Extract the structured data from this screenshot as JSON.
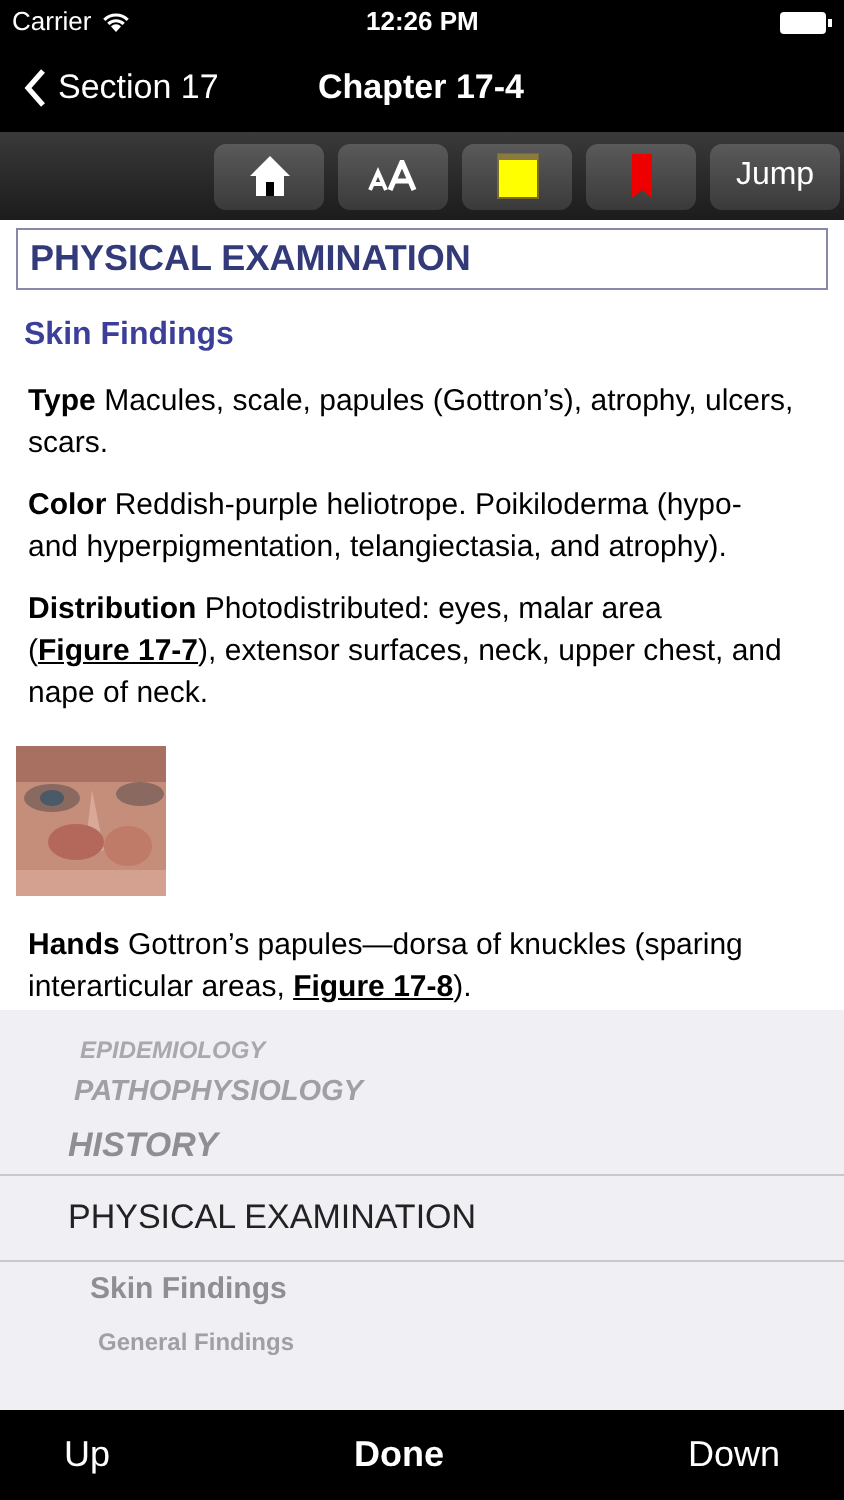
{
  "status_bar": {
    "carrier": "Carrier",
    "time": "12:26 PM"
  },
  "nav": {
    "back": "Section 17",
    "title": "Chapter 17-4"
  },
  "toolbar": {
    "jump": "Jump"
  },
  "content": {
    "heading": "PHYSICAL EXAMINATION",
    "subheading": "Skin Findings",
    "blocks": [
      {
        "kind": "paragraph",
        "parts": [
          {
            "kind": "term",
            "text": "Type"
          },
          {
            "kind": "text",
            "text": " Macules, scale, papules (Gottron’s), atrophy, ulcers, scars."
          }
        ]
      },
      {
        "kind": "paragraph",
        "parts": [
          {
            "kind": "term",
            "text": "Color"
          },
          {
            "kind": "text",
            "text": " Reddish-purple heliotrope. Poikiloderma (hypo- and hyperpigmentation, telangiectasia, and atrophy)."
          }
        ]
      },
      {
        "kind": "paragraph",
        "parts": [
          {
            "kind": "term",
            "text": "Distribution"
          },
          {
            "kind": "text",
            "text": " Photodistributed: eyes, malar area ("
          },
          {
            "kind": "link",
            "text": "Figure 17-7"
          },
          {
            "kind": "text",
            "text": "), extensor surfaces, neck, upper chest, and nape of neck."
          }
        ]
      },
      {
        "kind": "picture"
      },
      {
        "kind": "paragraph",
        "parts": [
          {
            "kind": "term",
            "text": "Hands"
          },
          {
            "kind": "text",
            "text": " Gottron’s papules—dorsa of knuckles (sparing interarticular areas, "
          },
          {
            "kind": "link",
            "text": "Figure 17-8"
          },
          {
            "kind": "text",
            "text": ")."
          }
        ]
      }
    ]
  },
  "picker": {
    "items": [
      {
        "kind": "section",
        "label": "EPIDEMIOLOGY",
        "selected": false
      },
      {
        "kind": "section",
        "label": "PATHOPHYSIOLOGY",
        "selected": false
      },
      {
        "kind": "section",
        "label": "HISTORY",
        "selected": false
      },
      {
        "kind": "section",
        "label": "PHYSICAL EXAMINATION",
        "selected": true
      },
      {
        "kind": "subsection",
        "label": "Skin Findings",
        "selected": false
      },
      {
        "kind": "subsubsection",
        "label": "General Findings",
        "selected": false
      }
    ]
  },
  "bottom_bar": {
    "up": "Up",
    "done": "Done",
    "down": "Down"
  }
}
